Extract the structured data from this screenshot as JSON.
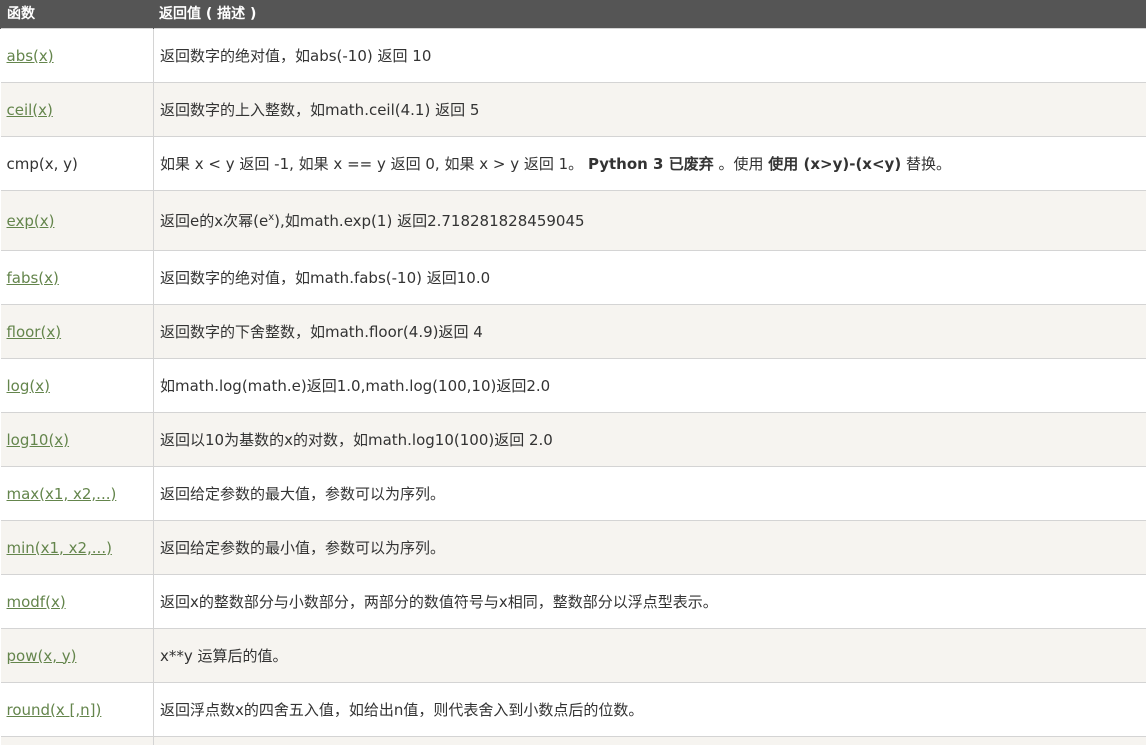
{
  "header": {
    "col_function": "函数",
    "col_return": "返回值 ( 描述 )"
  },
  "rows": [
    {
      "fn": "abs(x)",
      "desc": "返回数字的绝对值，如abs(-10) 返回 10"
    },
    {
      "fn": "ceil(x)",
      "desc": "返回数字的上入整数，如math.ceil(4.1) 返回 5"
    },
    {
      "fn": "cmp(x, y)",
      "desc_a": "如果 x < y 返回 -1, 如果 x == y 返回 0, 如果 x > y 返回 1。 ",
      "desc_b": "Python 3 已废弃",
      "desc_c": " 。使用 ",
      "desc_d": "使用 (x>y)-(x<y)",
      "desc_e": " 替换。"
    },
    {
      "fn": "exp(x)",
      "desc_a": "返回e的x次幂(e",
      "desc_sup": "x",
      "desc_b": "),如math.exp(1) 返回2.718281828459045"
    },
    {
      "fn": "fabs(x)",
      "desc": "返回数字的绝对值，如math.fabs(-10) 返回10.0"
    },
    {
      "fn": "floor(x)",
      "desc": "返回数字的下舍整数，如math.floor(4.9)返回 4"
    },
    {
      "fn": "log(x)",
      "desc": "如math.log(math.e)返回1.0,math.log(100,10)返回2.0"
    },
    {
      "fn": "log10(x)",
      "desc": "返回以10为基数的x的对数，如math.log10(100)返回 2.0"
    },
    {
      "fn": "max(x1, x2,...)",
      "desc": "返回给定参数的最大值，参数可以为序列。"
    },
    {
      "fn": "min(x1, x2,...)",
      "desc": "返回给定参数的最小值，参数可以为序列。"
    },
    {
      "fn": "modf(x)",
      "desc": "返回x的整数部分与小数部分，两部分的数值符号与x相同，整数部分以浮点型表示。"
    },
    {
      "fn": "pow(x, y)",
      "desc": "x**y 运算后的值。"
    },
    {
      "fn": "round(x [,n])",
      "desc": "返回浮点数x的四舍五入值，如给出n值，则代表舍入到小数点后的位数。"
    }
  ],
  "colors": {
    "header_bg": "#555555",
    "link": "#64854c",
    "alt_row": "#f6f4f0"
  }
}
